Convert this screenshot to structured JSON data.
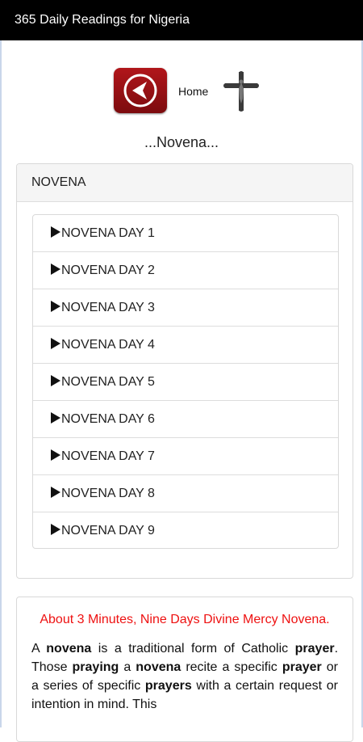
{
  "app": {
    "title": "365 Daily Readings for Nigeria"
  },
  "nav": {
    "home_label": "Home",
    "back_icon": "back-arrow-icon",
    "cross_icon": "crucifix-icon",
    "back_color": "#a51418"
  },
  "page": {
    "heading": "...Novena..."
  },
  "panel": {
    "header": "NOVENA",
    "items": [
      {
        "label": "NOVENA DAY 1"
      },
      {
        "label": "NOVENA DAY 2"
      },
      {
        "label": "NOVENA DAY 3"
      },
      {
        "label": "NOVENA DAY 4"
      },
      {
        "label": "NOVENA DAY 5"
      },
      {
        "label": "NOVENA DAY 6"
      },
      {
        "label": "NOVENA DAY 7"
      },
      {
        "label": "NOVENA DAY 8"
      },
      {
        "label": "NOVENA DAY 9"
      }
    ]
  },
  "about": {
    "title": "About 3 Minutes, Nine Days Divine Mercy Novena.",
    "title_color": "#ee1111",
    "body": [
      {
        "t": "A ",
        "b": false
      },
      {
        "t": "novena",
        "b": true
      },
      {
        "t": " is a traditional form of Catholic ",
        "b": false
      },
      {
        "t": "prayer",
        "b": true
      },
      {
        "t": ". Those ",
        "b": false
      },
      {
        "t": "praying",
        "b": true
      },
      {
        "t": " a ",
        "b": false
      },
      {
        "t": "novena",
        "b": true
      },
      {
        "t": " recite a specific ",
        "b": false
      },
      {
        "t": "prayer",
        "b": true
      },
      {
        "t": " or a series of specific ",
        "b": false
      },
      {
        "t": "prayers",
        "b": true
      },
      {
        "t": " with a certain request or intention in mind. This",
        "b": false
      }
    ]
  }
}
